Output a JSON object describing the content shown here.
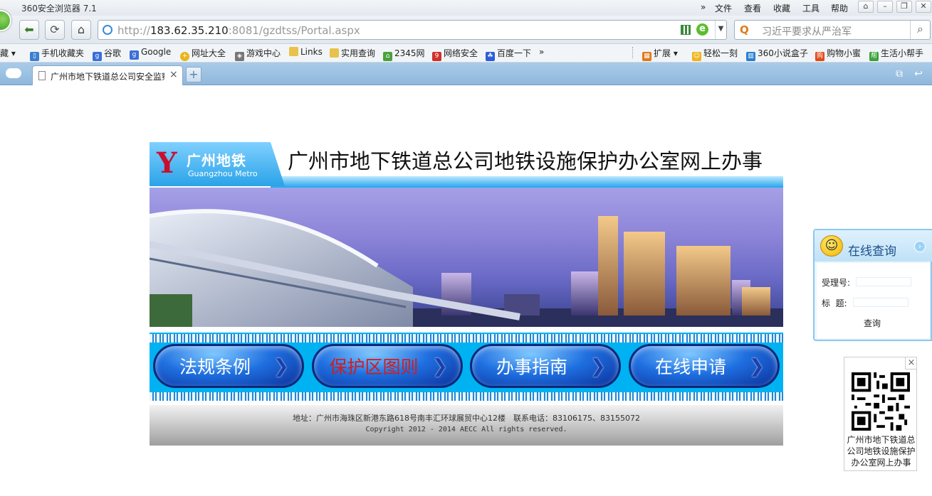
{
  "browser": {
    "app_title": "360安全浏览器 7.1",
    "menu": [
      "文件",
      "查看",
      "收藏",
      "工具",
      "帮助"
    ],
    "menu_overflow": "»",
    "url_prefix": "http://",
    "url_host": "183.62.35.210",
    "url_rest": ":8081/gzdtss/Portal.aspx",
    "search_placeholder": "习近平要求从严治军",
    "favorites": [
      {
        "label": "藏",
        "icon": "caret"
      },
      {
        "label": "手机收藏夹",
        "icon": "phone-icon",
        "color": "#3a7fd0"
      },
      {
        "label": "谷歌",
        "icon": "google-icon",
        "color": "#3b6fd6"
      },
      {
        "label": "Google",
        "icon": "google-icon",
        "color": "#3b6fd6"
      },
      {
        "label": "网址大全",
        "icon": "globe-icon",
        "color": "#e8b51a"
      },
      {
        "label": "游戏中心",
        "icon": "gamepad-icon",
        "color": "#777"
      },
      {
        "label": "Links",
        "icon": "folder-icon",
        "color": "#e8c24a"
      },
      {
        "label": "实用查询",
        "icon": "folder-icon",
        "color": "#e8c24a"
      },
      {
        "label": "2345网",
        "icon": "house-icon",
        "color": "#4aa23a"
      },
      {
        "label": "网络安全",
        "icon": "shield-icon",
        "color": "#d0302a"
      },
      {
        "label": "百度一下",
        "icon": "paw-icon",
        "color": "#2b5fd8"
      }
    ],
    "favorites_right": [
      {
        "label": "扩展",
        "icon": "grid-icon",
        "color": "#e07a1a"
      },
      {
        "label": "轻松一刻",
        "icon": "smile-icon",
        "color": "#f0b41a"
      },
      {
        "label": "360小说盒子",
        "icon": "book-icon",
        "color": "#2a7fd0"
      },
      {
        "label": "购物小蜜",
        "icon": "cart-icon",
        "color": "#e04a1a"
      },
      {
        "label": "生活小帮手",
        "icon": "help-icon",
        "color": "#3aa23a"
      }
    ],
    "tab_title": "广州市地下铁道总公司安全监察部",
    "new_tab_label": "+",
    "tab_close": "×"
  },
  "page": {
    "logo_cn": "广州地铁",
    "logo_en": "Guangzhou Metro",
    "site_title": "广州市地下铁道总公司地铁设施保护办公室网上办事",
    "nav_buttons": [
      {
        "label": "法规条例",
        "color": "#ffffff"
      },
      {
        "label": "保护区图则",
        "color": "#d31c1c"
      },
      {
        "label": "办事指南",
        "color": "#ffffff"
      },
      {
        "label": "在线申请",
        "color": "#ffffff"
      }
    ],
    "footer_address": "地址：广州市海珠区新港东路618号南丰汇环球展贸中心12楼　联系电话：83106175、83155072",
    "footer_copyright": "Copyright 2012 - 2014 AECC All rights reserved."
  },
  "query_widget": {
    "title": "在线查询",
    "acceptance_label": "受理号:",
    "acceptance_value": "",
    "subject_label": "标  题:",
    "subject_value": "",
    "submit_label": "查询"
  },
  "qr_widget": {
    "close_label": "×",
    "caption": "广州市地下铁道总公司地铁设施保护办公室网上办事"
  }
}
